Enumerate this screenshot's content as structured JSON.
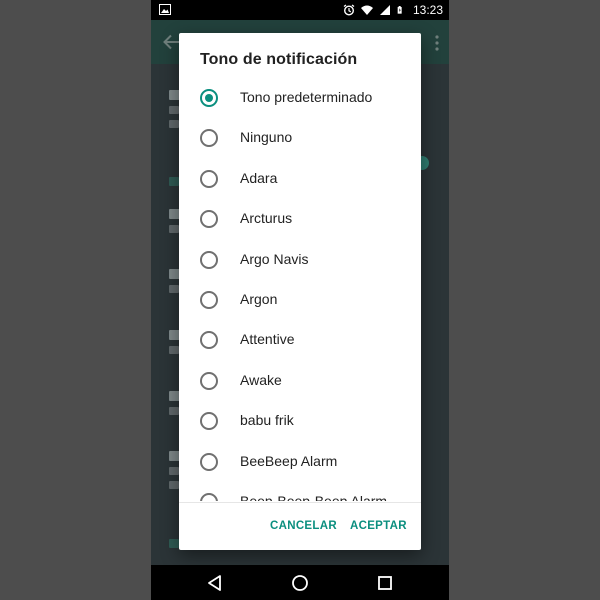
{
  "status_bar": {
    "time": "13:23",
    "icons": [
      "image-icon",
      "alarm-icon",
      "wifi-icon",
      "signal-icon",
      "battery-icon"
    ]
  },
  "dialog": {
    "title": "Tono de notificación",
    "options": [
      {
        "label": "Tono predeterminado",
        "selected": true
      },
      {
        "label": "Ninguno",
        "selected": false
      },
      {
        "label": "Adara",
        "selected": false
      },
      {
        "label": "Arcturus",
        "selected": false
      },
      {
        "label": "Argo Navis",
        "selected": false
      },
      {
        "label": "Argon",
        "selected": false
      },
      {
        "label": "Attentive",
        "selected": false
      },
      {
        "label": "Awake",
        "selected": false
      },
      {
        "label": "babu frik",
        "selected": false
      },
      {
        "label": "BeeBeep Alarm",
        "selected": false
      },
      {
        "label": "Beep-Beep-Beep Alarm",
        "selected": false
      }
    ],
    "cancel_label": "CANCELAR",
    "ok_label": "ACEPTAR"
  },
  "colors": {
    "accent": "#0b8f7f",
    "scrim": "#4d4d4d",
    "status_bar": "#000000"
  }
}
